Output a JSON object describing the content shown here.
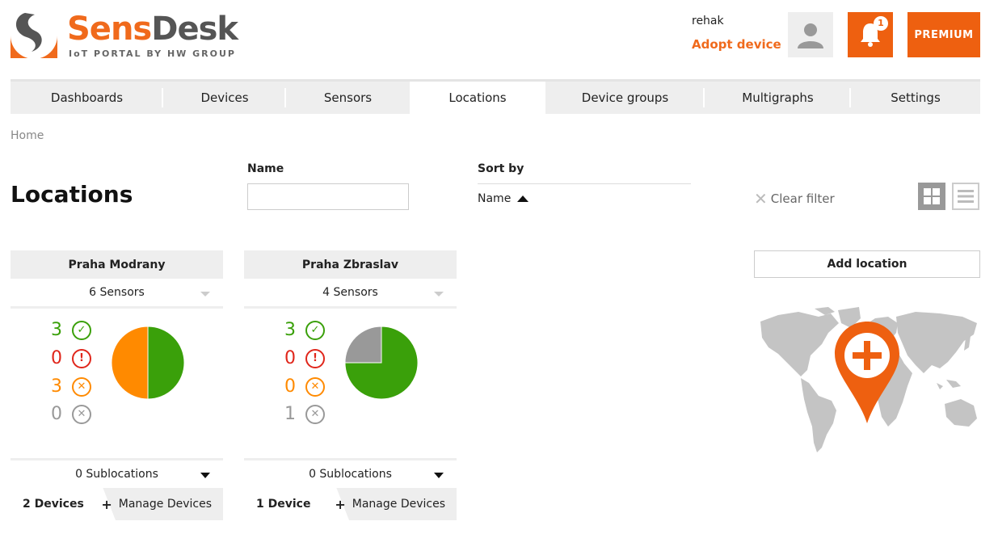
{
  "header": {
    "logo": {
      "brand_part1": "Sens",
      "brand_part2": "Desk",
      "tagline": "IoT PORTAL BY HW GROUP"
    },
    "username": "rehak",
    "adopt_device": "Adopt device",
    "notifications_count": "1",
    "premium_label": "PREMIUM",
    "accent_color": "#ee6010"
  },
  "tabs": [
    {
      "label": "Dashboards",
      "active": false
    },
    {
      "label": "Devices",
      "active": false
    },
    {
      "label": "Sensors",
      "active": false
    },
    {
      "label": "Locations",
      "active": true
    },
    {
      "label": "Device groups",
      "active": false
    },
    {
      "label": "Multigraphs",
      "active": false
    },
    {
      "label": "Settings",
      "active": false
    }
  ],
  "breadcrumb": "Home",
  "page_title": "Locations",
  "filter": {
    "name_label": "Name",
    "name_value": "",
    "sort_by_label": "Sort by",
    "sort_value": "Name",
    "sort_direction": "ascending",
    "clear_filter": "Clear filter",
    "view_mode": "grid"
  },
  "locations": [
    {
      "name": "Praha Modrany",
      "sensors": "6 Sensors",
      "stats": {
        "ok": "3",
        "alarm": "0",
        "warning": "3",
        "offline": "0"
      },
      "sublocations": "0 Sublocations",
      "devices": "2 Devices",
      "manage_devices": "Manage Devices"
    },
    {
      "name": "Praha Zbraslav",
      "sensors": "4 Sensors",
      "stats": {
        "ok": "3",
        "alarm": "0",
        "warning": "0",
        "offline": "1"
      },
      "sublocations": "0 Sublocations",
      "devices": "1 Device",
      "manage_devices": "Manage Devices"
    }
  ],
  "add_location": "Add location",
  "status_colors": {
    "ok": "#3aa00a",
    "alarm": "#e0261b",
    "warning": "#ff8a00",
    "offline": "#999999"
  }
}
